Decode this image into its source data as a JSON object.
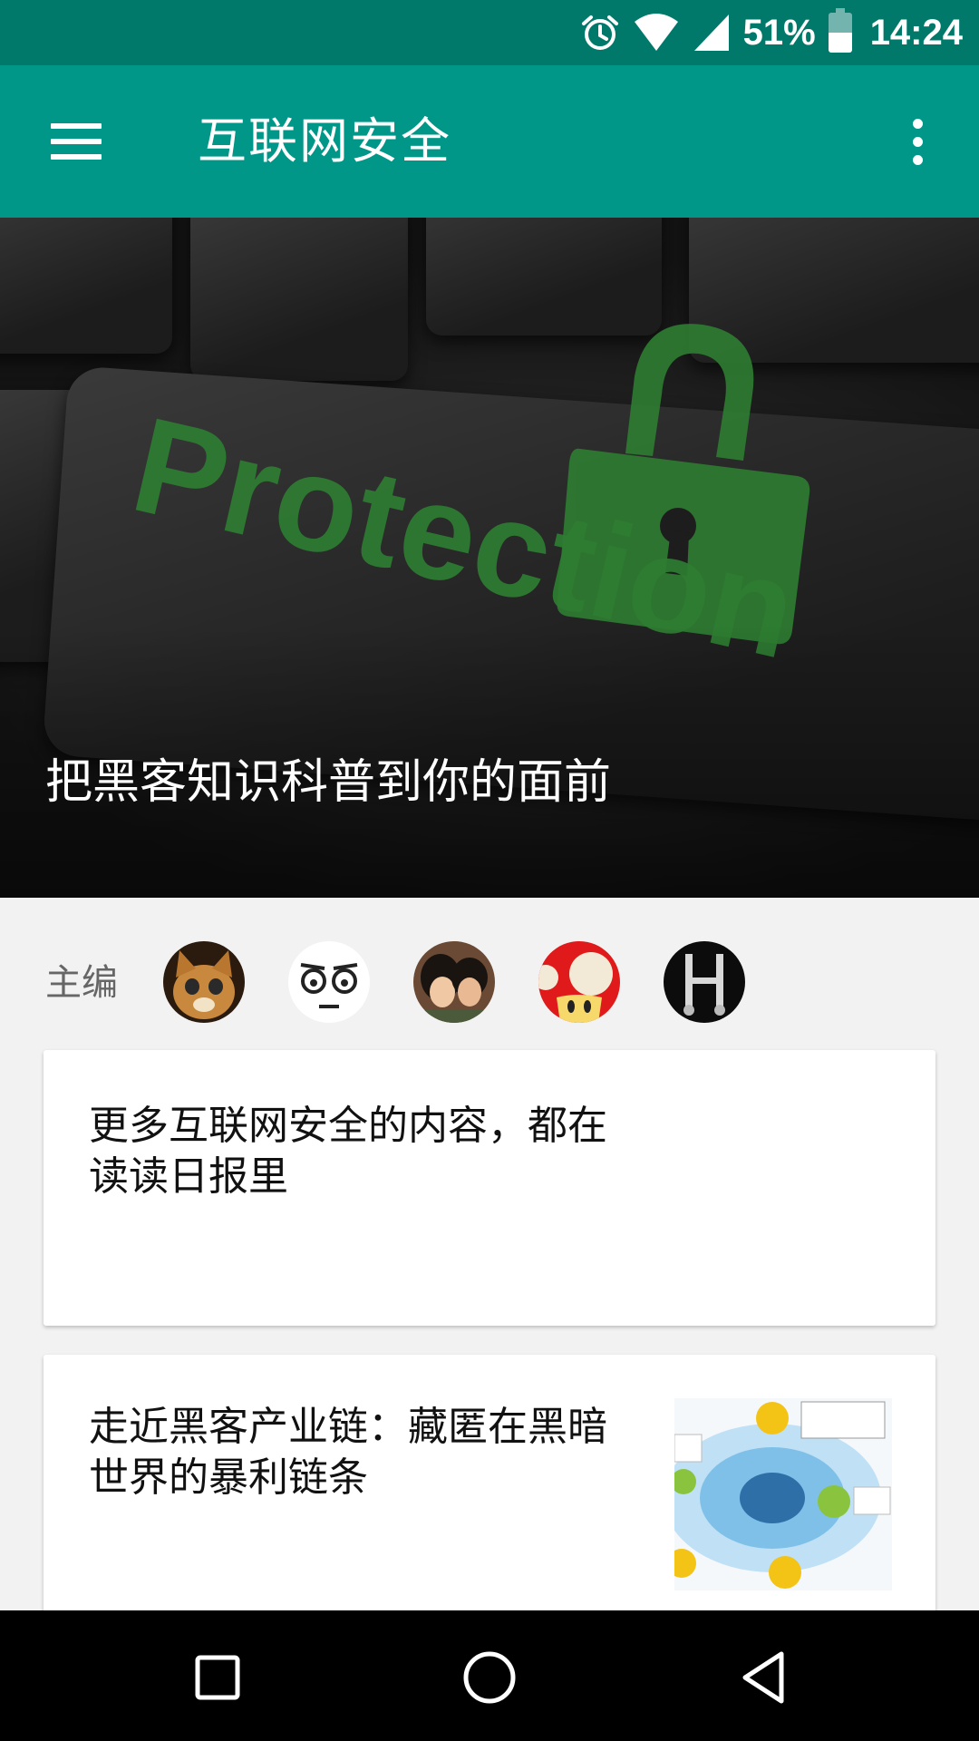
{
  "status_bar": {
    "battery_percent": "51%",
    "time": "14:24",
    "icons": [
      "alarm-icon",
      "wifi-icon",
      "cell-signal-icon",
      "battery-icon"
    ]
  },
  "app_bar": {
    "title": "互联网安全",
    "menu_icon": "hamburger-menu-icon",
    "more_icon": "more-vert-icon"
  },
  "hero": {
    "title": "把黑客知识科普到你的面前",
    "image_text": "Protection"
  },
  "editors": {
    "label": "主编",
    "avatars": [
      "cat-avatar",
      "face-avatar",
      "couple-avatar",
      "mushroom-avatar",
      "tools-avatar"
    ]
  },
  "cards": [
    {
      "title": "更多互联网安全的内容，都在读读日报里"
    },
    {
      "title": "走近黑客产业链：藏匿在黑暗世界的暴利链条"
    }
  ],
  "nav_bar": {
    "icons": [
      "recents-square-icon",
      "home-circle-icon",
      "back-triangle-icon"
    ]
  },
  "colors": {
    "status_bar": "#00796b",
    "app_bar": "#009688",
    "background": "#f2f2f2"
  }
}
